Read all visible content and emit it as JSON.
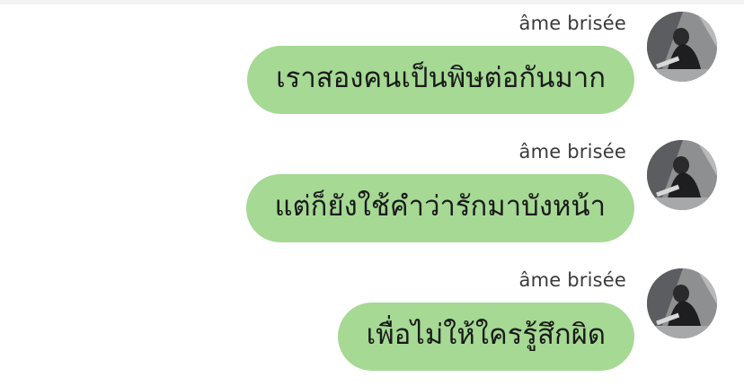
{
  "conversation": {
    "messages": [
      {
        "sender": "âme brisée",
        "text": "เราสองคนเป็นพิษต่อกันมาก"
      },
      {
        "sender": "âme brisée",
        "text": "แต่ก็ยังใช้คำว่ารักมาบังหน้า"
      },
      {
        "sender": "âme brisée",
        "text": "เพื่อไม่ให้ใครรู้สึกผิด"
      }
    ]
  },
  "colors": {
    "bubble": "#a5d994",
    "sender_text": "#3a3a3a",
    "message_text": "#1a1a1a"
  },
  "icons": {
    "avatar": "profile-photo-avatar"
  }
}
